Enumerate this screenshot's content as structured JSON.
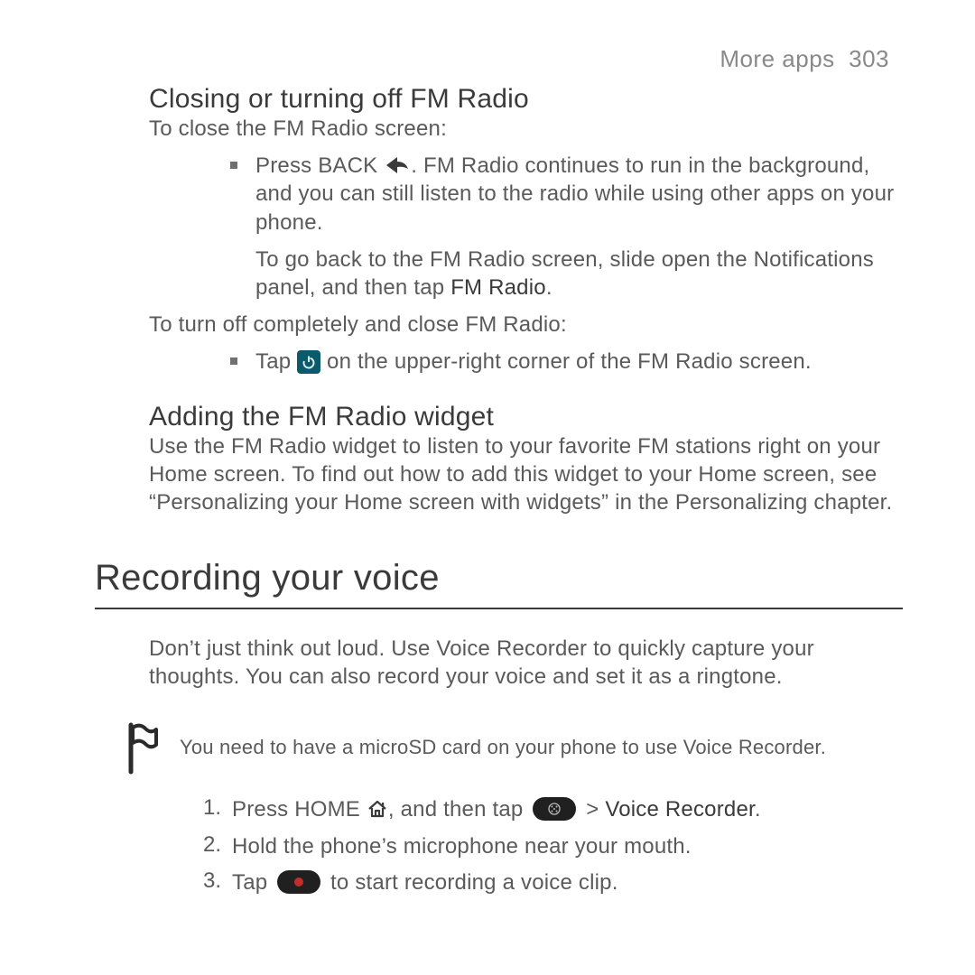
{
  "header": {
    "section": "More apps",
    "page_num": "303"
  },
  "s1": {
    "heading": "Closing or turning off FM Radio",
    "intro": "To close the FM Radio screen:",
    "b1_pre": "Press BACK ",
    "b1_post": ". FM Radio continues to run in the background, and you can still listen to the radio while using other apps on your phone.",
    "b1_note_pre": "To go back to the FM Radio screen, slide open the Notifications panel, and then tap ",
    "b1_note_strong": "FM Radio",
    "b1_note_post": ".",
    "mid": "To turn off completely and close FM Radio:",
    "b2_pre": "Tap ",
    "b2_post": " on the upper-right corner of the FM Radio screen."
  },
  "s2": {
    "heading": "Adding the FM Radio widget",
    "body": "Use the FM Radio widget to listen to your favorite FM stations right on your Home screen. To find out how to add this widget to your Home screen, see “Personalizing your Home screen with widgets” in the Personalizing chapter."
  },
  "s3": {
    "h1": "Recording your voice",
    "intro": "Don’t just think out loud. Use Voice Recorder to quickly capture your thoughts. You can also record your voice and set it as a ringtone.",
    "note": "You need to have a microSD card on your phone to use Voice Recorder.",
    "li1_pre": "Press HOME ",
    "li1_mid": ", and then tap ",
    "li1_gt": " > ",
    "li1_strong": "Voice Recorder",
    "li1_post": ".",
    "li2": "Hold the phone’s microphone near your mouth.",
    "li3_pre": "Tap ",
    "li3_post": " to start recording a voice clip.",
    "n1": "1.",
    "n2": "2.",
    "n3": "3."
  }
}
